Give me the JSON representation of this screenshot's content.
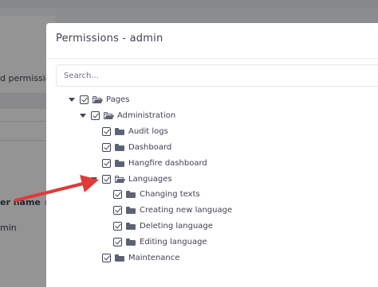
{
  "background": {
    "heading_fragment": "d permission",
    "column_header": "er name",
    "column_sort_glyph": "⇕",
    "cell_value": "min"
  },
  "modal": {
    "title": "Permissions - admin",
    "search": {
      "placeholder": "Search...",
      "value": ""
    }
  },
  "tree": [
    {
      "label": "Pages",
      "level": 0,
      "expandable": true,
      "expanded": true,
      "checked": true,
      "folder_open": true
    },
    {
      "label": "Administration",
      "level": 1,
      "expandable": true,
      "expanded": true,
      "checked": true,
      "folder_open": true
    },
    {
      "label": "Audit logs",
      "level": 2,
      "expandable": false,
      "checked": true,
      "folder_open": false
    },
    {
      "label": "Dashboard",
      "level": 2,
      "expandable": false,
      "checked": true,
      "folder_open": false
    },
    {
      "label": "Hangfire dashboard",
      "level": 2,
      "expandable": false,
      "checked": true,
      "folder_open": false
    },
    {
      "label": "Languages",
      "level": 2,
      "expandable": true,
      "expanded": true,
      "checked": true,
      "folder_open": true
    },
    {
      "label": "Changing texts",
      "level": 3,
      "expandable": false,
      "checked": true,
      "folder_open": false
    },
    {
      "label": "Creating new language",
      "level": 3,
      "expandable": false,
      "checked": true,
      "folder_open": false
    },
    {
      "label": "Deleting language",
      "level": 3,
      "expandable": false,
      "checked": true,
      "folder_open": false
    },
    {
      "label": "Editing language",
      "level": 3,
      "expandable": false,
      "checked": true,
      "folder_open": false
    },
    {
      "label": "Maintenance",
      "level": 2,
      "expandable": false,
      "checked": true,
      "folder_open": false
    }
  ],
  "colors": {
    "annotation_arrow": "#e03a3a",
    "text": "#3f4254",
    "overlay": "#000000"
  },
  "annotation": {
    "icon": "arrow-icon",
    "points_to": "Hangfire dashboard"
  }
}
